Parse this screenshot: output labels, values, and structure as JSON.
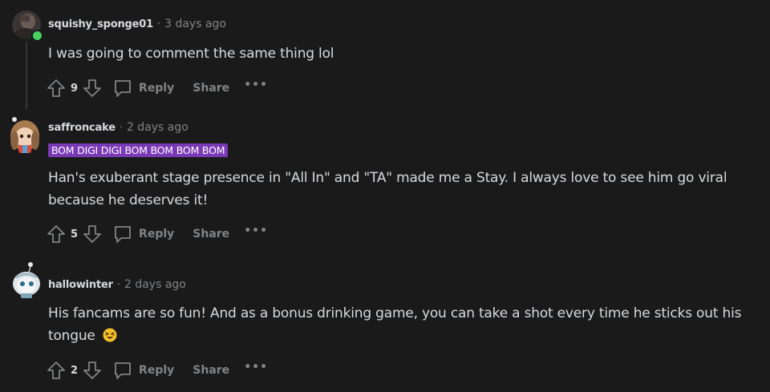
{
  "comments": [
    {
      "username": "squishy_sponge01",
      "separator": "·",
      "time": "3 days ago",
      "flair": "",
      "body": "I was going to comment the same thing lol",
      "votes": "9",
      "reply_label": "Reply",
      "share_label": "Share",
      "more_label": "•••",
      "online": true
    },
    {
      "username": "saffroncake",
      "separator": "·",
      "time": "2 days ago",
      "flair": "BOM DIGI DIGI BOM BOM BOM BOM",
      "body_line1": "Han's exuberant stage presence in \"All In\" and \"TA\" made me a Stay. I always love to see him go viral",
      "body_line2": "because he deserves it!",
      "votes": "5",
      "reply_label": "Reply",
      "share_label": "Share",
      "more_label": "•••"
    },
    {
      "username": "hallowinter",
      "separator": "·",
      "time": "2 days ago",
      "flair": "",
      "body_line1": "His fancams are so fun! And as a bonus drinking game, you can take a shot every time he sticks out his",
      "body_line2": "tongue",
      "emoji": "laughing-squint-emoji",
      "votes": "2",
      "reply_label": "Reply",
      "share_label": "Share",
      "more_label": "•••"
    }
  ],
  "colors": {
    "background": "#1a1a1b",
    "text": "#d7dadc",
    "muted": "#818384",
    "flair_bg": "#7b3ab5",
    "online": "#46d160"
  },
  "icons": {
    "upvote": "upvote-arrow-icon",
    "downvote": "downvote-arrow-icon",
    "reply": "speech-bubble-icon"
  }
}
